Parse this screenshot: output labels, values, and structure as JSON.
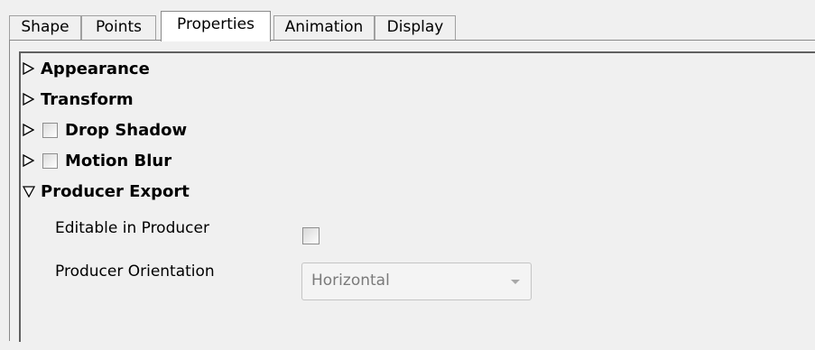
{
  "tabs": [
    {
      "label": "Shape",
      "active": false
    },
    {
      "label": "Points",
      "active": false
    },
    {
      "label": "Properties",
      "active": true
    },
    {
      "label": "Animation",
      "active": false
    },
    {
      "label": "Display",
      "active": false
    }
  ],
  "sections": [
    {
      "label": "Appearance",
      "expanded": false,
      "has_checkbox": false,
      "checked": false,
      "arrow_icon": "collapsed-triangle-icon"
    },
    {
      "label": "Transform",
      "expanded": false,
      "has_checkbox": false,
      "checked": false,
      "arrow_icon": "collapsed-triangle-icon"
    },
    {
      "label": "Drop Shadow",
      "expanded": false,
      "has_checkbox": true,
      "checked": false,
      "arrow_icon": "collapsed-triangle-icon"
    },
    {
      "label": "Motion Blur",
      "expanded": false,
      "has_checkbox": true,
      "checked": false,
      "arrow_icon": "collapsed-triangle-icon"
    },
    {
      "label": "Producer Export",
      "expanded": true,
      "has_checkbox": false,
      "checked": false,
      "arrow_icon": "expanded-triangle-icon"
    }
  ],
  "producer_export": {
    "editable_label": "Editable in Producer",
    "editable_checked": false,
    "orientation_label": "Producer Orientation",
    "orientation_value": "Horizontal",
    "orientation_enabled": false
  },
  "colors": {
    "window_bg": "#f0f0f0",
    "active_tab_bg": "#ffffff",
    "disabled_text": "#7a7a7a"
  }
}
